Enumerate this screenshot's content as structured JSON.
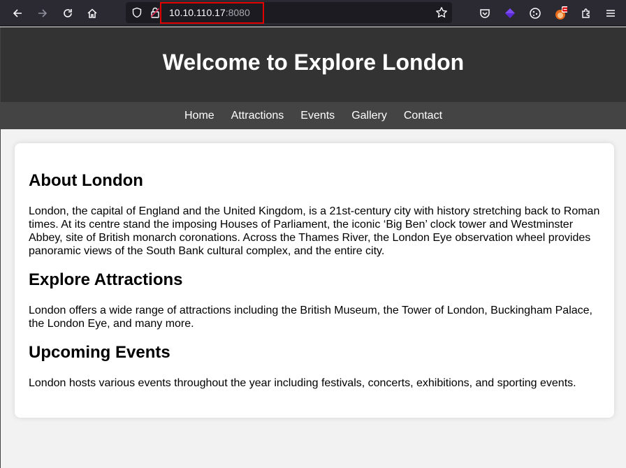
{
  "browser": {
    "url_host": "10.10.110.17",
    "url_port": ":8080"
  },
  "site": {
    "title": "Welcome to Explore London",
    "nav": [
      "Home",
      "Attractions",
      "Events",
      "Gallery",
      "Contact"
    ]
  },
  "sections": [
    {
      "title": "About London",
      "text": "London, the capital of England and the United Kingdom, is a 21st-century city with history stretching back to Roman times. At its centre stand the imposing Houses of Parliament, the iconic ‘Big Ben’ clock tower and Westminster Abbey, site of British monarch coronations. Across the Thames River, the London Eye observation wheel provides panoramic views of the South Bank cultural complex, and the entire city."
    },
    {
      "title": "Explore Attractions",
      "text": "London offers a wide range of attractions including the British Museum, the Tower of London, Buckingham Palace, the London Eye, and many more."
    },
    {
      "title": "Upcoming Events",
      "text": "London hosts various events throughout the year including festivals, concerts, exhibitions, and sporting events."
    }
  ],
  "colors": {
    "header_bg": "#333333",
    "nav_bg": "#444444",
    "page_bg": "#f2f2f2",
    "url_highlight": "#e00000"
  }
}
